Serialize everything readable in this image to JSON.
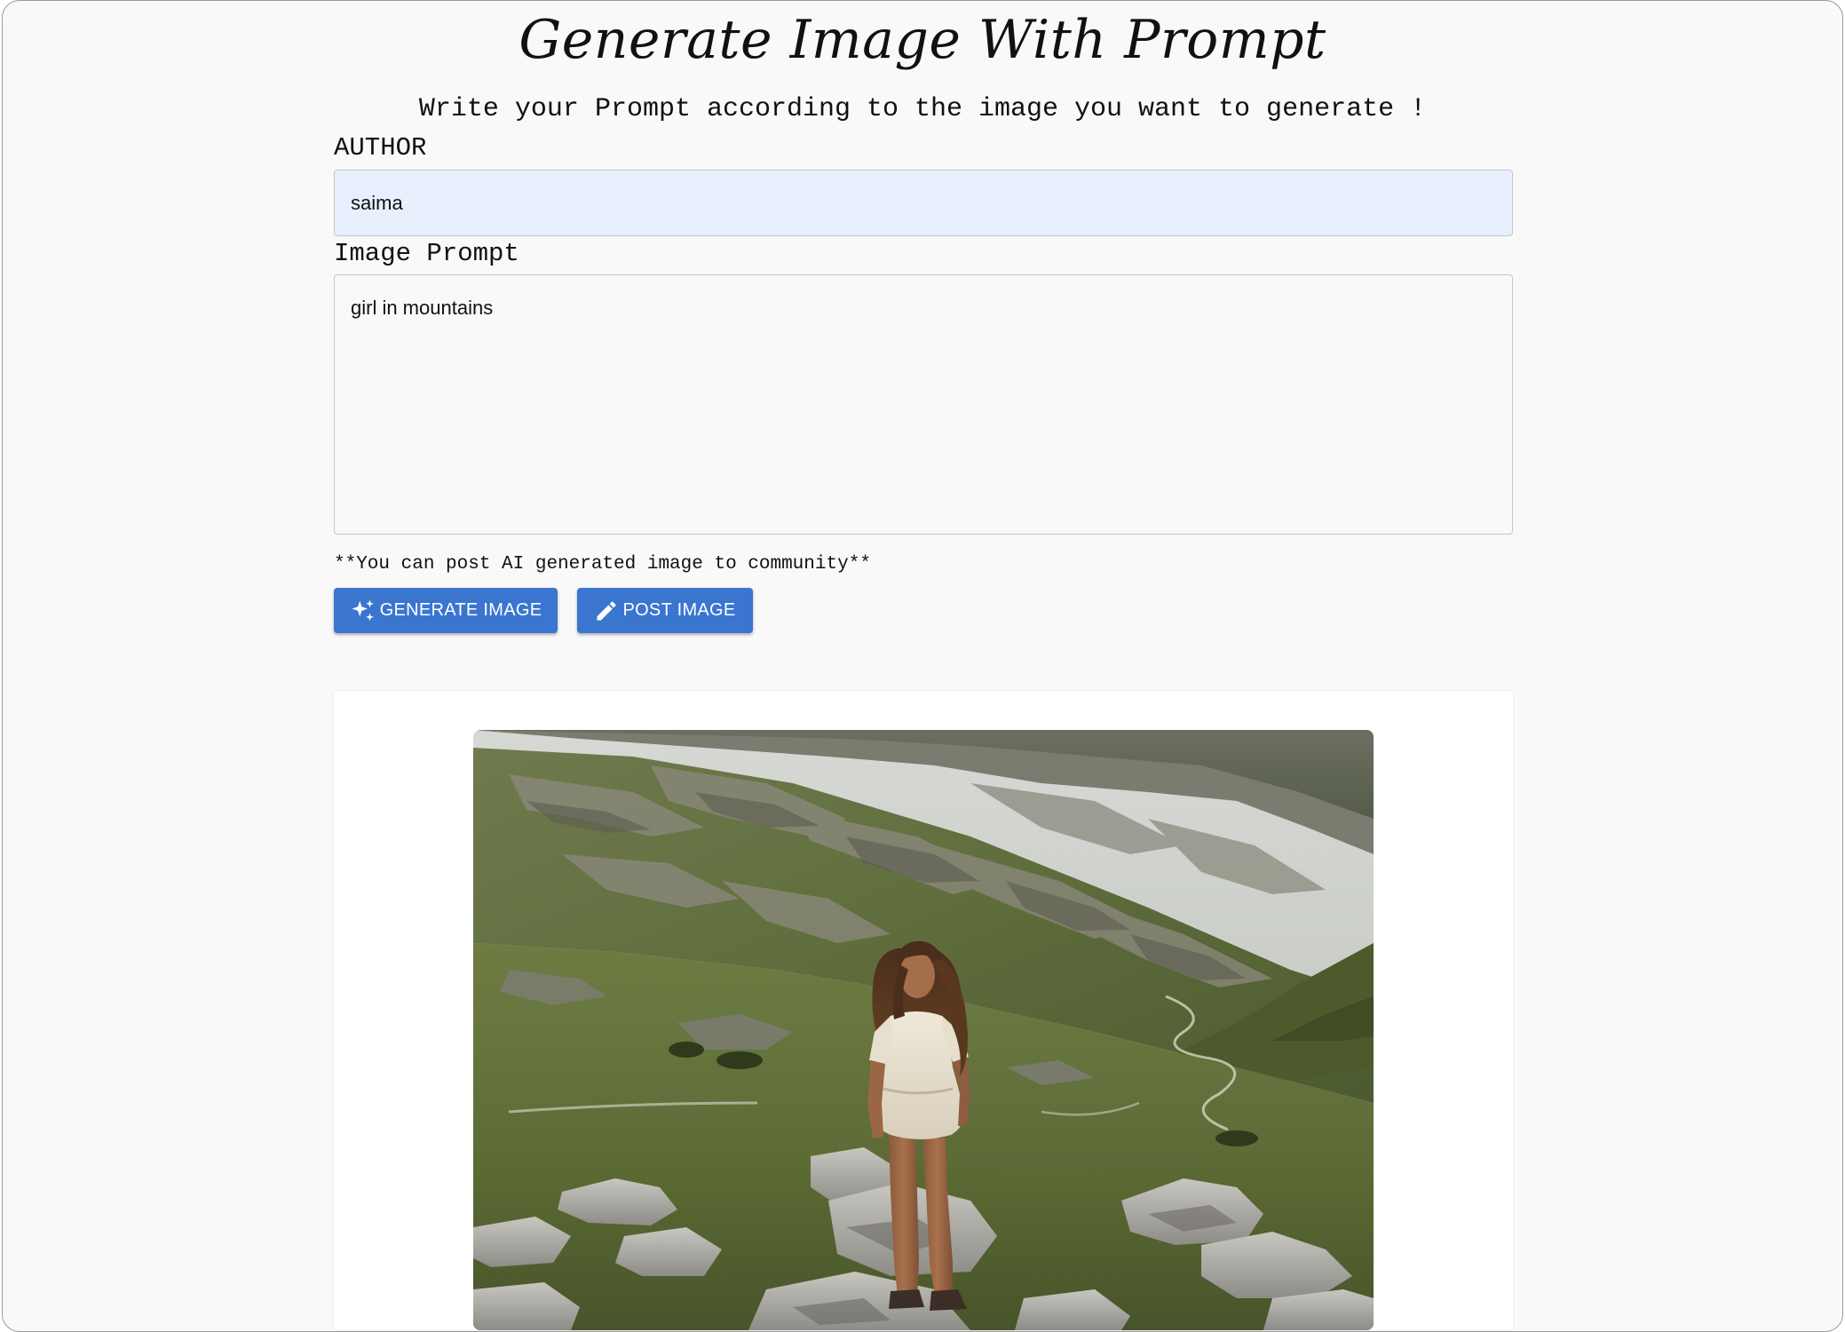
{
  "page": {
    "title": "Generate Image With Prompt",
    "subtitle": "Write your Prompt according to the image you want to generate !"
  },
  "form": {
    "author_label": "AUTHOR",
    "author_value": "saima",
    "prompt_label": "Image Prompt",
    "prompt_value": "girl in mountains",
    "hint": "**You can post AI generated image to community**"
  },
  "actions": {
    "generate_label": "GENERATE IMAGE",
    "post_label": "POST IMAGE"
  },
  "result": {
    "image_alt": "girl in mountains"
  },
  "colors": {
    "button": "#3a76d0",
    "author_field_bg": "#e8effd",
    "page_bg": "#f9f9f9"
  },
  "icons": {
    "generate": "sparkle-icon",
    "post": "pencil-icon"
  }
}
